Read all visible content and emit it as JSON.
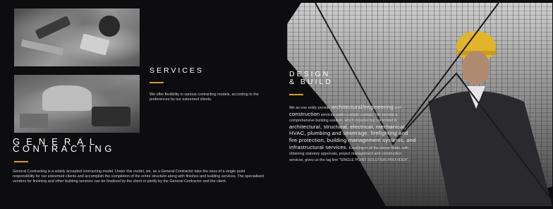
{
  "general_contracting": {
    "title_line1": "GENERAL",
    "title_line2": "CONTRACTING",
    "body": "General Contracting is a widely accepted contracting model. Under this model, we, as a General Contractor take the onus of a single point responsibility for our esteemed clients and accomplish the completion of the entire structure along with finishes and building services. The specialised vendors for finishing and other building services can be finalised by the client or jointly by the General Contractor and the client."
  },
  "services": {
    "title": "SERVICES",
    "body": "We offer flexibility in various contracting models, according to the preferences by our esteemed clients."
  },
  "design_build": {
    "title_line1": "DESIGN",
    "title_line2": "& BUILD",
    "body_parts": [
      "We as one entity provide ",
      "architectural/engineering",
      " and ",
      "construction",
      " services under a single contract. We provide a comprehensive building solution, which includes but not limited to ",
      "architectural, structural, electrical, mechanical, HVAC, plumbing and sewerage, firefighting and fire protection, building management systems, and infrastructural services.",
      " Excelling in all the above fields, with obtaining statutory approvals, project management and construction services, gives us the tag line \"SINGLE POINT SOLUTION PROVIDER\"."
    ]
  },
  "colors": {
    "background": "#0d0d0f",
    "accent": "#d89a2a",
    "text": "#d2d2d2"
  }
}
